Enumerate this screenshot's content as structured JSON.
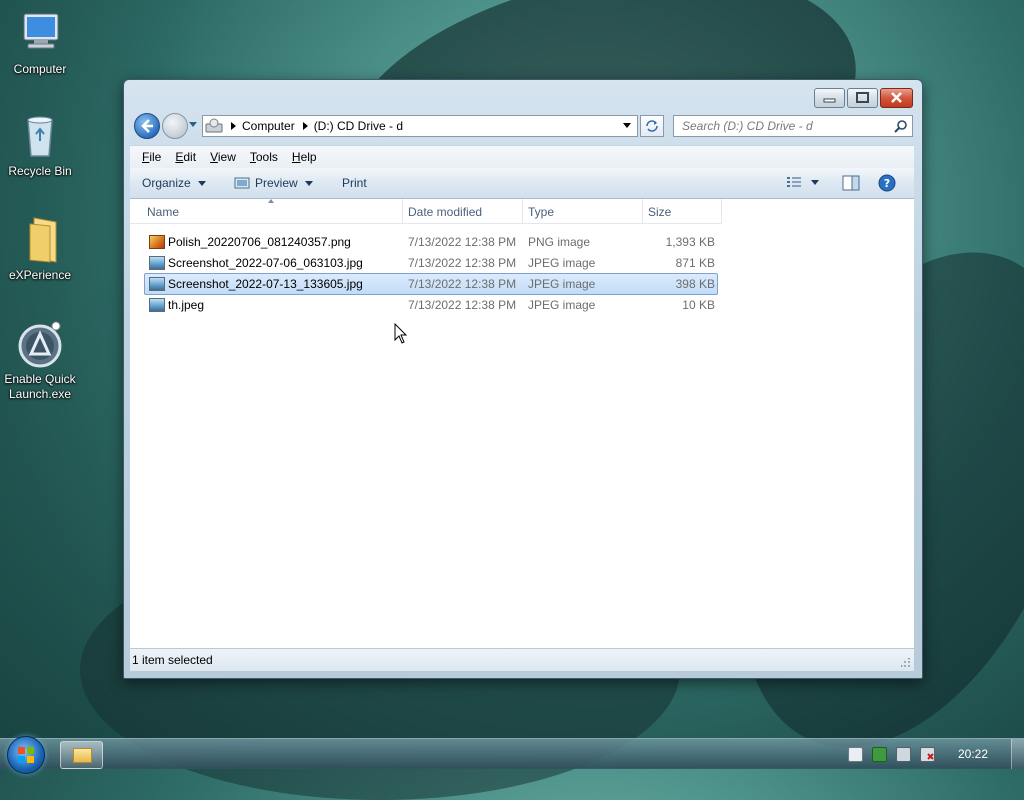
{
  "desktop": {
    "icons": [
      {
        "label": "Computer",
        "icon": "computer-icon"
      },
      {
        "label": "Recycle Bin",
        "icon": "recycle-bin-icon"
      },
      {
        "label": "eXPerience",
        "icon": "folder-icon"
      },
      {
        "label": "Enable Quick Launch.exe",
        "icon": "quick-launch-icon"
      }
    ]
  },
  "window": {
    "address": {
      "segments": [
        "Computer",
        "(D:) CD Drive - d"
      ]
    },
    "search": {
      "placeholder": "Search (D:) CD Drive - d"
    },
    "menu": [
      "File",
      "Edit",
      "View",
      "Tools",
      "Help"
    ],
    "toolbar": {
      "organize": "Organize",
      "preview": "Preview",
      "print": "Print"
    },
    "columns": {
      "name": "Name",
      "date": "Date modified",
      "type": "Type",
      "size": "Size"
    },
    "files": [
      {
        "name": "Polish_20220706_081240357.png",
        "date": "7/13/2022 12:38 PM",
        "type": "PNG image",
        "size": "1,393 KB",
        "selected": false
      },
      {
        "name": "Screenshot_2022-07-06_063103.jpg",
        "date": "7/13/2022 12:38 PM",
        "type": "JPEG image",
        "size": "871 KB",
        "selected": false
      },
      {
        "name": "Screenshot_2022-07-13_133605.jpg",
        "date": "7/13/2022 12:38 PM",
        "type": "JPEG image",
        "size": "398 KB",
        "selected": true
      },
      {
        "name": "th.jpeg",
        "date": "7/13/2022 12:38 PM",
        "type": "JPEG image",
        "size": "10 KB",
        "selected": false
      }
    ],
    "status": "1 item selected"
  },
  "taskbar": {
    "clock": "20:22"
  }
}
